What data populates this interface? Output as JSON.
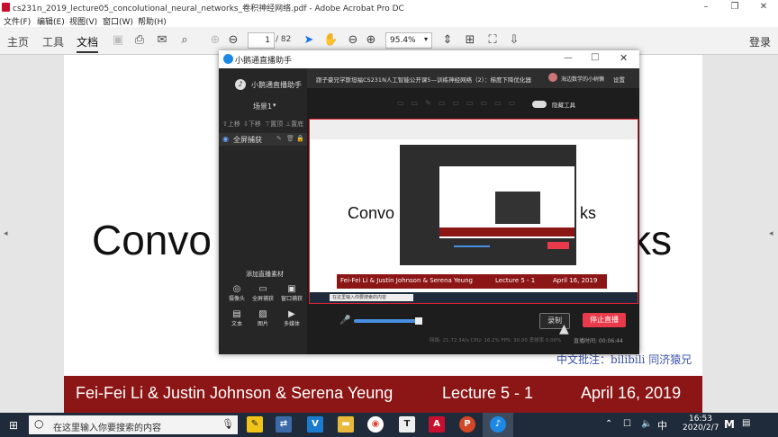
{
  "window": {
    "title": "cs231n_2019_lecture05_concolutional_neural_networks_卷积神经网络.pdf - Adobe Acrobat Pro DC"
  },
  "menu": [
    "文件(F)",
    "编辑(E)",
    "视图(V)",
    "窗口(W)",
    "帮助(H)"
  ],
  "toolbar": {
    "tabs": [
      "主页",
      "工具",
      "文档"
    ],
    "active_tab": "文档",
    "page_current": "1",
    "page_total": "/ 82",
    "zoom": "95.4%",
    "login": "登录"
  },
  "document": {
    "title_left": "Convo",
    "title_right": "ks",
    "footer_authors": "Fei-Fei Li & Justin Johnson & Serena Yeung",
    "footer_lecture": "Lecture 5 -  1",
    "footer_date": "April 16, 2019",
    "annotation": "中文批注：bilibili 同济猿兄"
  },
  "stream_app": {
    "title": "小鹅通直播助手",
    "brand": "小鹅通直播助手",
    "scene": "场景1",
    "source_actions": [
      "上移",
      "下移",
      "置顶",
      "置底"
    ],
    "source_item": "全屏捕获",
    "course_title": "跟子豪兄学斯坦福CS231N人工智能公开课5—训练神经网络（2）：梯度下降优化器",
    "user": "海边数学的小树懒",
    "settings": "设置",
    "beauty": "隐藏工具",
    "add_material": "添加直播素材",
    "materials": [
      "摄像头",
      "全屏捕获",
      "窗口捕获",
      "文本",
      "图片",
      "多媒体"
    ],
    "record_label": "录制",
    "stop_label": "停止直播",
    "status": "网络: 21.72.34/s  CPU: 16.2%  FPS: 30.00  丢帧率 0.00%",
    "live_time": "直播时间: 00:06:44",
    "preview_slide_left": "Convo",
    "preview_slide_right": "ks",
    "preview_footer_authors": "Fei-Fei Li & Justin Johnson & Serena Yeung",
    "preview_footer_lecture": "Lecture 5 - 1",
    "preview_footer_date": "April 16, 2019",
    "preview_search": "在这里输入你要搜索的内容"
  },
  "taskbar": {
    "search_placeholder": "在这里输入你要搜索的内容",
    "time": "16:53",
    "date": "2020/2/7",
    "ime": "中",
    "apps": [
      "note-app",
      "network-app",
      "vscode-app",
      "file-explorer",
      "chrome",
      "typora",
      "acrobat",
      "powerpoint",
      "stream-app"
    ]
  },
  "colors": {
    "stanford_red": "#8c1515",
    "stop_red": "#e83a4a",
    "taskbar": "#1f2b3a"
  }
}
